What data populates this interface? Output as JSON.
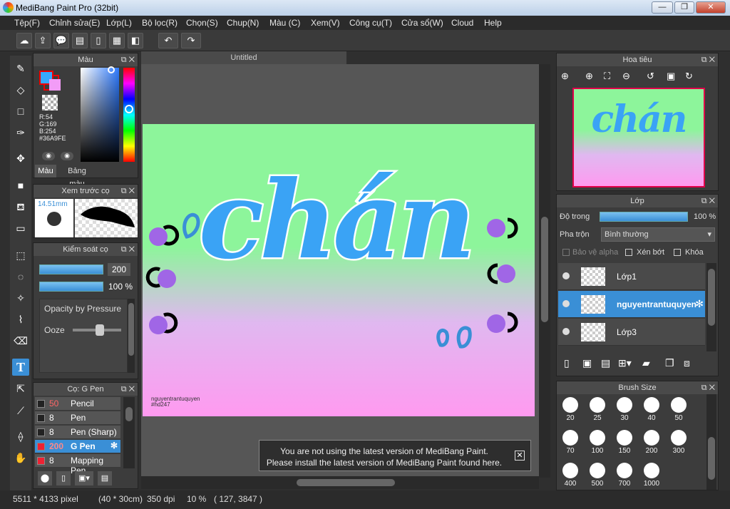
{
  "window": {
    "title": "MediBang Paint Pro (32bit)",
    "minimize": "—",
    "maximize": "❐",
    "close": "✕"
  },
  "menu": [
    "Tệp(F)",
    "Chỉnh sửa(E)",
    "Lớp(L)",
    "Bộ lọc(R)",
    "Chọn(S)",
    "Chup(N)",
    "Màu (C)",
    "Xem(V)",
    "Công cụ(T)",
    "Cửa sổ(W)",
    "Cloud",
    "Help"
  ],
  "toolbar_icons": [
    "cloud-icon",
    "share-icon",
    "speech-bubble-icon",
    "comment-icon",
    "page-icon",
    "grid-icon",
    "panel-icon",
    "undo-icon",
    "redo-icon"
  ],
  "tools": [
    "brush-icon",
    "eraser-icon",
    "rectangle-icon",
    "pen-icon",
    "move-icon",
    "fill-square-icon",
    "bucket-icon",
    "gradient-icon",
    "select-rect-icon",
    "lasso-icon",
    "magic-wand-icon",
    "select-pen-icon",
    "select-eraser-icon",
    "text-icon",
    "operation-icon",
    "dropper-icon",
    "eyedropper-icon",
    "hand-icon"
  ],
  "color_panel": {
    "title": "Màu",
    "r": "R:54",
    "g": "G:169",
    "b": "B:254",
    "hex": "#36A9FE",
    "fg_color": "#36a9fe",
    "bg_color": "#f29cf7",
    "tab_color": "Màu",
    "tab_palette": "Bảng màu"
  },
  "brush_preview": {
    "title": "Xem trước cọ",
    "size": "14.51mm"
  },
  "brush_control": {
    "title": "Kiểm soát cọ",
    "size_value": "200",
    "opacity_value": "100 %",
    "opacity_by_pressure": "Opacity by Pressure",
    "ooze": "Ooze"
  },
  "brush_list": {
    "title": "Cọ: G Pen",
    "items": [
      {
        "size": "50",
        "name": "Pencil",
        "swatch": "dark",
        "selected": false
      },
      {
        "size": "8",
        "name": "Pen",
        "swatch": "dark",
        "selected": false
      },
      {
        "size": "8",
        "name": "Pen (Sharp)",
        "swatch": "dark",
        "selected": false
      },
      {
        "size": "200",
        "name": "G Pen",
        "swatch": "red",
        "selected": true
      },
      {
        "size": "8",
        "name": "Mapping Pen",
        "swatch": "red",
        "selected": false
      }
    ]
  },
  "document": {
    "tab": "Untitled",
    "artwork_text": "chán",
    "signature_line1": "nguyentrantuquyen",
    "signature_line2": "#hd247"
  },
  "notification": {
    "line1": "You are not using the latest version of MediBang Paint.",
    "line2": "Please install the latest version of MediBang Paint found here."
  },
  "navigator": {
    "title": "Hoa tiêu",
    "preview_text": "chán"
  },
  "layers": {
    "title": "Lớp",
    "opacity_label": "Độ trong",
    "opacity_value": "100 %",
    "opacity_fraction": 1.0,
    "blend_label": "Pha trộn",
    "blend_value": "Bình thường",
    "protect_alpha": "Bảo vệ alpha",
    "clipping": "Xén bớt",
    "lock": "Khóa",
    "items": [
      {
        "name": "Lớp1",
        "selected": false
      },
      {
        "name": "nguyentrantuquyen",
        "selected": true
      },
      {
        "name": "Lớp3",
        "selected": false
      }
    ]
  },
  "brush_size": {
    "title": "Brush Size",
    "sizes": [
      "20",
      "25",
      "30",
      "40",
      "50",
      "70",
      "100",
      "150",
      "200",
      "300",
      "400",
      "500",
      "700",
      "1000"
    ]
  },
  "status": {
    "dimensions": "5511 * 4133 pixel",
    "physical": "(40 * 30cm)",
    "dpi": "350 dpi",
    "zoom": "10 %",
    "coords": "( 127, 3847 )"
  }
}
